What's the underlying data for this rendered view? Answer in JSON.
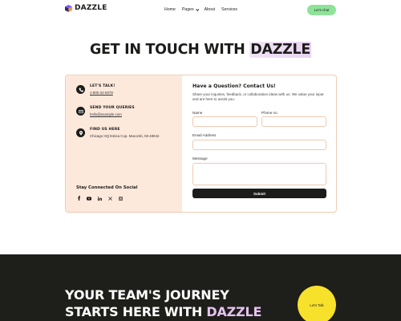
{
  "brand": {
    "name": "DAZZLE"
  },
  "nav": {
    "items": [
      "Home",
      "Pages",
      "About",
      "Services"
    ],
    "cta": "Let's chat"
  },
  "hero": {
    "title_prefix": "GET IN TOUCH WITH ",
    "title_highlight": "DAZZLE"
  },
  "contact": {
    "items": [
      {
        "heading": "LET'S TALK!",
        "value": "1-800-22-6078",
        "icon": "phone-icon"
      },
      {
        "heading": "SEND YOUR QUERIES",
        "value": "hello@example.com",
        "icon": "mail-icon"
      },
      {
        "heading": "FIND US HERE",
        "value": "Chicago HQ Estica Cop. Macomb, MI 48042",
        "icon": "location-pin-icon"
      }
    ],
    "social_title": "Stay Connected On Social",
    "social_icons": [
      "facebook-icon",
      "youtube-icon",
      "linkedin-icon",
      "x-twitter-icon",
      "instagram-icon"
    ]
  },
  "form": {
    "title": "Have a Question? Contact Us!",
    "description": "Share your inquiries, feedback, or collaboration ideas with us. We value your input and are here to assist you.",
    "name_label": "Name",
    "phone_label": "Phone no",
    "email_label": "Email Address",
    "message_label": "Message",
    "submit_label": "Submit"
  },
  "band": {
    "line1": "YOUR TEAM'S JOURNEY",
    "line2_prefix": "STARTS HERE WITH ",
    "line2_highlight": "DAZZLE",
    "cta": "Let's Talk"
  },
  "colors": {
    "accent_green": "#8ee39a",
    "peach": "#fde9dc",
    "dark": "#1e1e1b",
    "yellow": "#f7e12b",
    "lavender": "#e6c3f0"
  }
}
